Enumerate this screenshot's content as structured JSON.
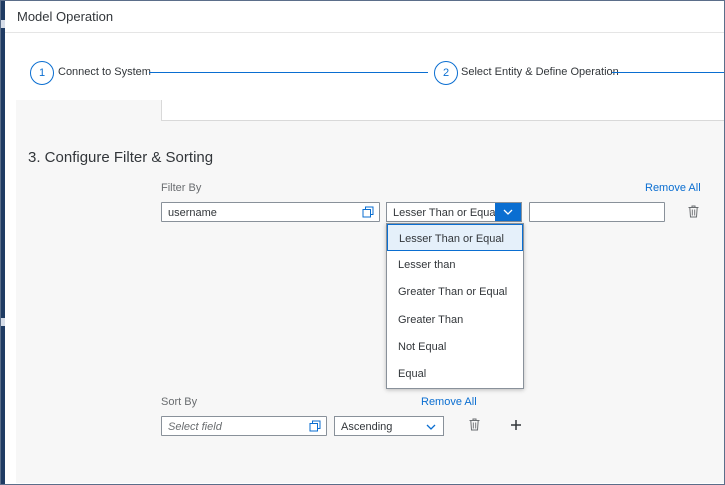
{
  "window": {
    "title": "Model Operation"
  },
  "wizard": {
    "steps": [
      {
        "number": "1",
        "label": "Connect to System"
      },
      {
        "number": "2",
        "label": "Select Entity & Define Operation"
      }
    ]
  },
  "section": {
    "title": "3. Configure Filter & Sorting"
  },
  "filter": {
    "label": "Filter By",
    "remove_all": "Remove All",
    "field_value": "username",
    "operator_value": "Lesser Than or Equal",
    "value_input": "",
    "operator_options": [
      "Lesser Than or Equal",
      "Lesser than",
      "Greater Than or Equal",
      "Greater Than",
      "Not Equal",
      "Equal"
    ],
    "selected_option": "Lesser Than or Equal"
  },
  "sort": {
    "label": "Sort By",
    "remove_all": "Remove All",
    "field_placeholder": "Select field",
    "order_value": "Ascending"
  },
  "colors": {
    "accent": "#0a6ed1",
    "text": "#32363a",
    "muted": "#6a6d70",
    "background": "#f7f7f7"
  },
  "icons": [
    "value-help-icon",
    "chevron-down-icon",
    "delete-icon",
    "add-icon"
  ]
}
